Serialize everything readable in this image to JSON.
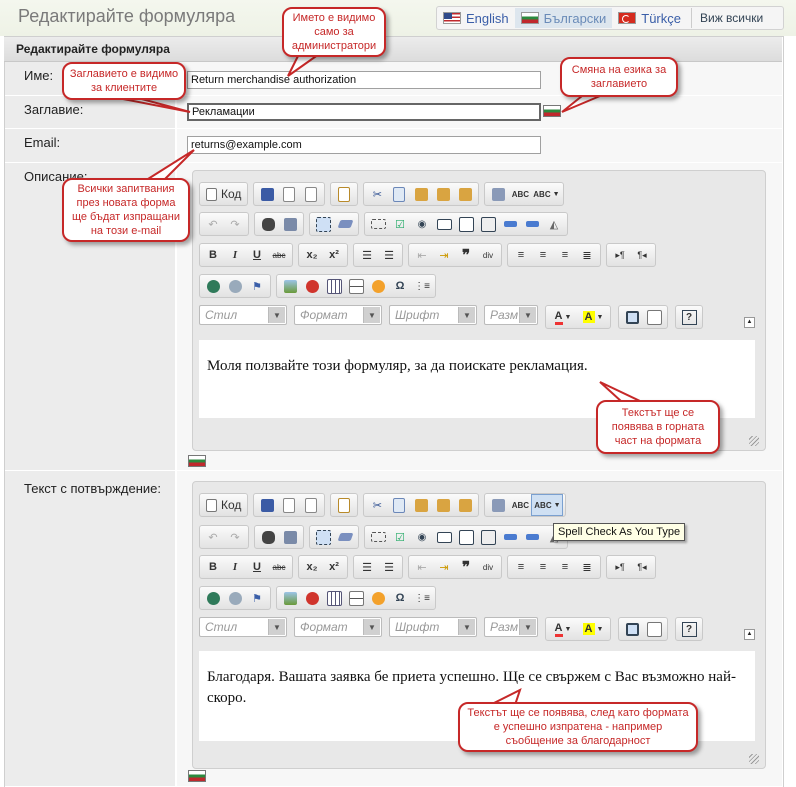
{
  "page": {
    "title": "Редактирайте формуляра"
  },
  "languages": [
    {
      "label": "English",
      "flag": "us-flag-icon",
      "active": false
    },
    {
      "label": "Български",
      "flag": "bg-flag-icon",
      "active": true
    },
    {
      "label": "Türkçe",
      "flag": "tr-flag-icon",
      "active": false
    }
  ],
  "view_all": "Виж всички",
  "form": {
    "header": "Редактирайте формуляра",
    "name_label": "Име:",
    "name_value": "Return merchandise authorization",
    "title_label": "Заглавие:",
    "title_value": "Рекламации",
    "email_label": "Email:",
    "email_value": "returns@example.com",
    "description_label": "Описание:",
    "description_text": "Моля ползвайте този формуляр, за да поискате рекламация.",
    "confirmation_label": "Текст с потвърждение:",
    "confirmation_text": "Благодаря. Вашата заявка бе приета успешно. Ще се свържем с Вас възможно най-скоро."
  },
  "editor": {
    "source_label": "Код",
    "style_placeholder": "Стил",
    "format_placeholder": "Формат",
    "font_placeholder": "Шрифт",
    "size_placeholder": "Разм",
    "bold": "B",
    "italic": "I",
    "underline": "U",
    "strike": "abc",
    "subscript": "x₂",
    "superscript": "x²",
    "spell": "ABC"
  },
  "tooltip": "Spell Check As You Type",
  "callouts": {
    "admin_only": "Името е видимо само за администратори",
    "client_visible": "Заглавието е видимо за клиентите",
    "change_lang": "Смяна на езика за заглавието",
    "queries_sent": "Всички запитвания през новата форма ще бъдат изпращани на този e-mail",
    "top_text": "Текстът ще се появява в горната част на формата",
    "after_submit": "Текстът ще се появява, след като формата е успешно изпратена - например  съобщение за благодарност"
  },
  "colors": {
    "accent_red": "#c62828",
    "link_blue": "#3a5ea8",
    "bg_flag_green": "#2b8a3e"
  }
}
